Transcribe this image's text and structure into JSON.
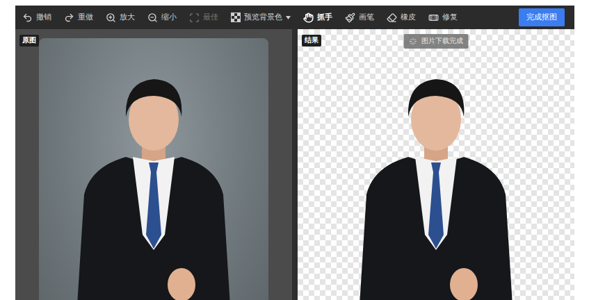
{
  "toolbar": {
    "tools": [
      {
        "label": "撤销",
        "kind": "button",
        "disabled": false,
        "selected": false
      },
      {
        "label": "重做",
        "kind": "button",
        "disabled": false,
        "selected": false
      },
      {
        "label": "放大",
        "kind": "button",
        "disabled": false,
        "selected": false
      },
      {
        "label": "缩小",
        "kind": "button",
        "disabled": false,
        "selected": false
      },
      {
        "label": "最佳",
        "kind": "button",
        "disabled": true,
        "selected": false
      },
      {
        "label": "预览背景色",
        "kind": "dropdown",
        "disabled": false,
        "selected": false
      },
      {
        "label": "抓手",
        "kind": "button",
        "disabled": false,
        "selected": true
      },
      {
        "label": "画笔",
        "kind": "button",
        "disabled": false,
        "selected": false
      },
      {
        "label": "橡皮",
        "kind": "button",
        "disabled": false,
        "selected": false
      },
      {
        "label": "修复",
        "kind": "button",
        "disabled": false,
        "selected": false
      }
    ],
    "primary_button": "完成抠图"
  },
  "panels": [
    {
      "badge": "原图",
      "kind": "original"
    },
    {
      "badge": "结果",
      "kind": "result"
    }
  ],
  "toast": "图片下载完成"
}
